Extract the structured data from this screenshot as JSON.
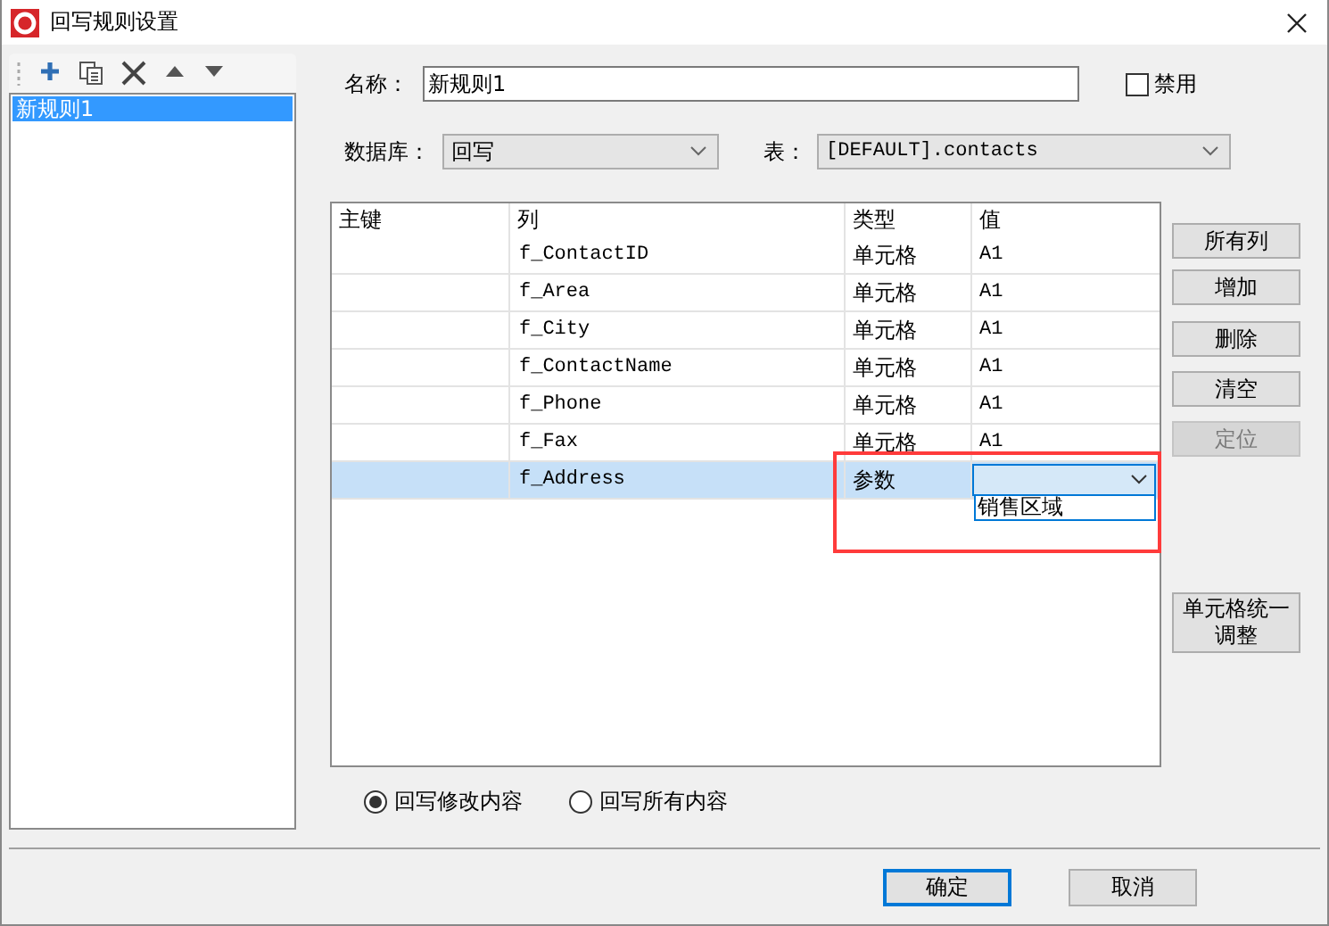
{
  "window": {
    "title": "回写规则设置"
  },
  "toolbar": [
    {
      "kind": "add"
    },
    {
      "kind": "copy"
    },
    {
      "kind": "delete"
    },
    {
      "kind": "up"
    },
    {
      "kind": "down"
    }
  ],
  "rules": [
    {
      "label": "新规则1",
      "selected": true
    }
  ],
  "form": {
    "name_label": "名称：",
    "name_value": "新规则1",
    "disable": {
      "label": "禁用",
      "checked": false
    },
    "database_label": "数据库：",
    "database": "回写",
    "table_label": "表：",
    "table": "[DEFAULT].contacts"
  },
  "grid": {
    "columns": [
      "主键",
      "列",
      "类型",
      "值"
    ],
    "rows": [
      {
        "column": "f_ContactID",
        "type": "单元格",
        "value": "A1",
        "selected": false,
        "highlighted": false
      },
      {
        "column": "f_Area",
        "type": "单元格",
        "value": "A1",
        "selected": false,
        "highlighted": false
      },
      {
        "column": "f_City",
        "type": "单元格",
        "value": "A1",
        "selected": false,
        "highlighted": false
      },
      {
        "column": "f_ContactName",
        "type": "单元格",
        "value": "A1",
        "selected": false,
        "highlighted": false
      },
      {
        "column": "f_Phone",
        "type": "单元格",
        "value": "A1",
        "selected": false,
        "highlighted": false
      },
      {
        "column": "f_Fax",
        "type": "单元格",
        "value": "A1",
        "selected": false,
        "highlighted": false
      },
      {
        "column": "f_Address",
        "type": "参数",
        "selected": true,
        "highlighted": true,
        "editor": {
          "kind": "dropdown",
          "options": [
            "销售区域"
          ]
        }
      }
    ]
  },
  "side_buttons": [
    {
      "label": "所有列",
      "disabled": false
    },
    {
      "label": "增加",
      "disabled": false
    },
    {
      "label": "删除",
      "disabled": false
    },
    {
      "label": "清空",
      "disabled": false
    },
    {
      "label": "定位",
      "disabled": true
    }
  ],
  "cell_adjust_button": {
    "label": "单元格统一调整"
  },
  "radios": [
    {
      "label": "回写修改内容",
      "selected": true
    },
    {
      "label": "回写所有内容",
      "selected": false
    }
  ],
  "footer_buttons": [
    {
      "label": "确定",
      "default": true
    },
    {
      "label": "取消",
      "default": false
    }
  ]
}
